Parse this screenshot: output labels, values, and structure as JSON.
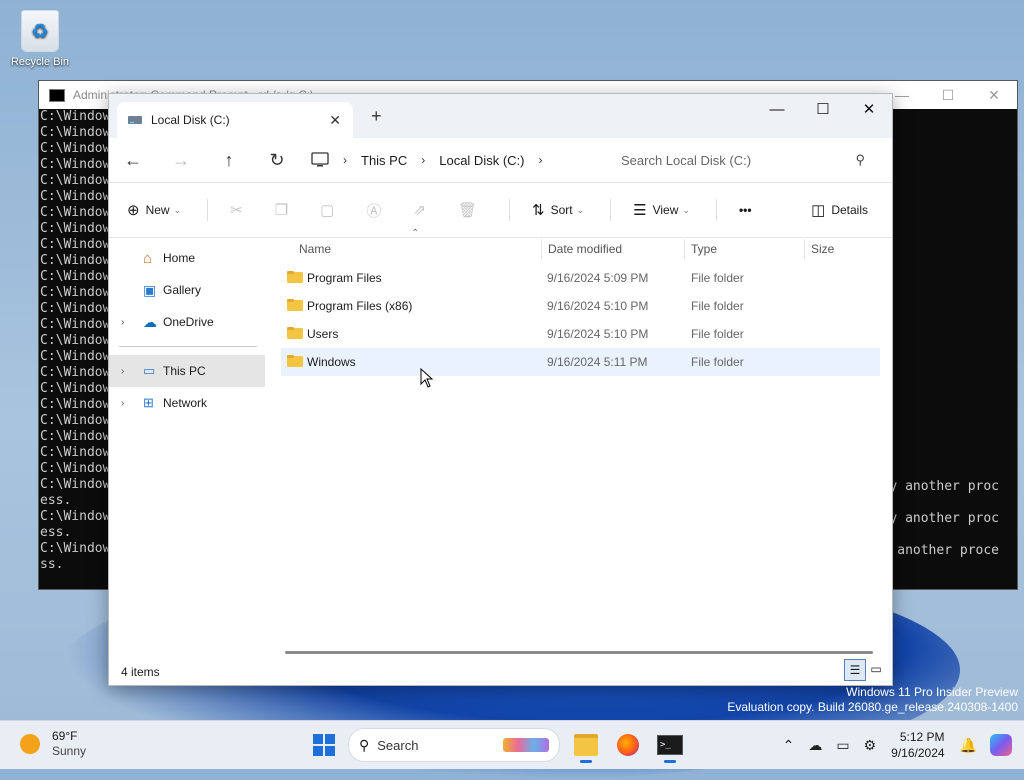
{
  "desktop": {
    "recycle_bin_label": "Recycle Bin",
    "watermark_line1": "Windows 11 Pro Insider Preview",
    "watermark_line2": "Evaluation copy. Build 26080.ge_release.240308-1400"
  },
  "cmd": {
    "title": "Administrator: Command Prompt - rd /s /q C:\\",
    "lines": [
      "C:\\Window",
      "C:\\Window",
      "C:\\Window",
      "C:\\Window",
      "C:\\Window",
      "C:\\Window",
      "C:\\Window",
      "C:\\Window",
      "C:\\Window",
      "C:\\Window",
      "C:\\Window",
      "C:\\Window",
      "C:\\Window",
      "C:\\Window",
      "C:\\Window",
      "C:\\Window",
      "C:\\Window",
      "C:\\Window",
      "C:\\Window",
      "C:\\Window",
      "C:\\Window",
      "C:\\Window",
      "C:\\Window",
      "C:\\Window",
      "ess.",
      "C:\\Window",
      "ess.",
      "C:\\Window",
      "ss."
    ],
    "right_lines": [
      "y another proc",
      "y another proc",
      "another proce"
    ]
  },
  "explorer": {
    "tab_title": "Local Disk (C:)",
    "breadcrumb": [
      "This PC",
      "Local Disk (C:)"
    ],
    "search_placeholder": "Search Local Disk (C:)",
    "toolbar": {
      "new_label": "New",
      "sort_label": "Sort",
      "view_label": "View",
      "more_label": "•••",
      "details_label": "Details"
    },
    "sidebar": {
      "home": "Home",
      "gallery": "Gallery",
      "onedrive": "OneDrive",
      "thispc": "This PC",
      "network": "Network"
    },
    "columns": {
      "name": "Name",
      "date": "Date modified",
      "type": "Type",
      "size": "Size"
    },
    "rows": [
      {
        "name": "Program Files",
        "date": "9/16/2024 5:09 PM",
        "type": "File folder"
      },
      {
        "name": "Program Files (x86)",
        "date": "9/16/2024 5:10 PM",
        "type": "File folder"
      },
      {
        "name": "Users",
        "date": "9/16/2024 5:10 PM",
        "type": "File folder"
      },
      {
        "name": "Windows",
        "date": "9/16/2024 5:11 PM",
        "type": "File folder"
      }
    ],
    "status": "4 items"
  },
  "taskbar": {
    "weather_temp": "69°F",
    "weather_cond": "Sunny",
    "search_label": "Search",
    "time": "5:12 PM",
    "date": "9/16/2024"
  },
  "colors": {
    "accent": "#1e6fd9",
    "folder": "#f4c443",
    "selected_row": "#eaf3fd"
  }
}
